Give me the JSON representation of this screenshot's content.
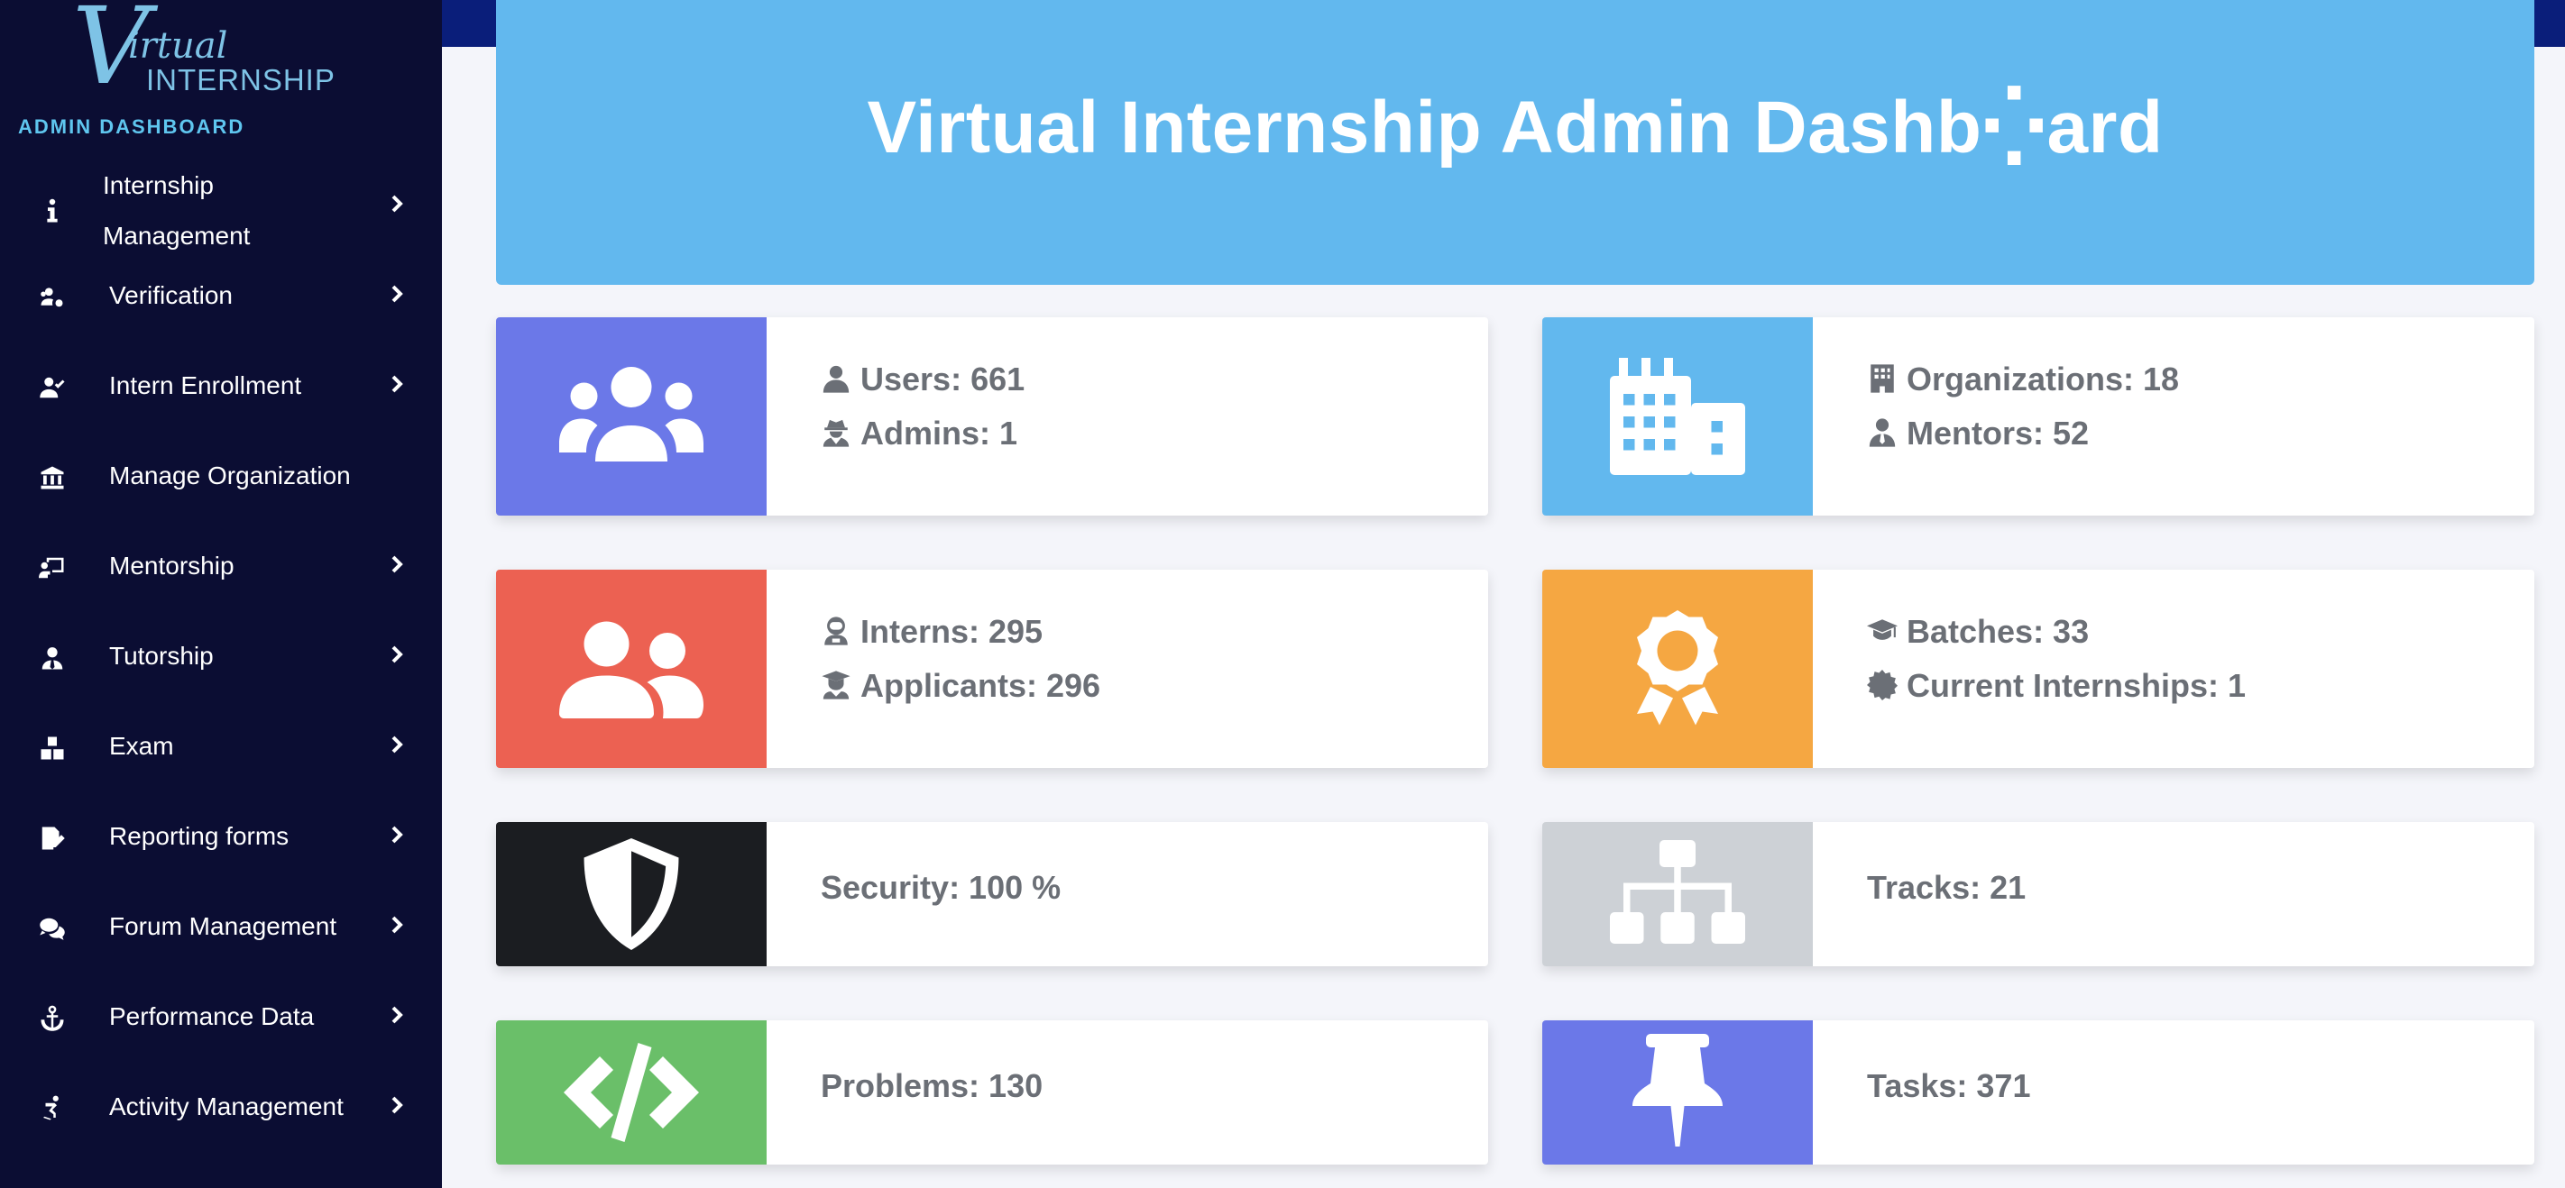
{
  "brand": {
    "logo_v": "V",
    "logo_word1": "irtual",
    "logo_word2": "INTERNSHIP",
    "section_label": "ADMIN DASHBOARD"
  },
  "sidebar": {
    "items": [
      {
        "label": "Internship Management",
        "icon": "info-icon",
        "has_chevron": true
      },
      {
        "label": "Verification",
        "icon": "users-cog-icon",
        "has_chevron": true
      },
      {
        "label": "Intern Enrollment",
        "icon": "user-check-icon",
        "has_chevron": true
      },
      {
        "label": "Manage Organization",
        "icon": "landmark-icon",
        "has_chevron": false
      },
      {
        "label": "Mentorship",
        "icon": "chalkboard-teacher-icon",
        "has_chevron": true
      },
      {
        "label": "Tutorship",
        "icon": "user-tie-icon",
        "has_chevron": true
      },
      {
        "label": "Exam",
        "icon": "cubes-icon",
        "has_chevron": true
      },
      {
        "label": "Reporting forms",
        "icon": "file-signature-icon",
        "has_chevron": true
      },
      {
        "label": "Forum Management",
        "icon": "comments-icon",
        "has_chevron": true
      },
      {
        "label": "Performance Data",
        "icon": "anchor-icon",
        "has_chevron": true
      },
      {
        "label": "Activity Management",
        "icon": "skating-icon",
        "has_chevron": true
      }
    ]
  },
  "header": {
    "title": "Virtual Internship Admin Dashb⁛ard"
  },
  "cards": {
    "users": {
      "color": "#6b78e8",
      "icon": "users-icon",
      "lines": [
        "Users: 661",
        "Admins: 1"
      ],
      "line_icons": [
        "user-icon",
        "user-secret-icon"
      ]
    },
    "orgs": {
      "color": "#62b8ee",
      "icon": "building-icon",
      "lines": [
        "Organizations: 18",
        "Mentors: 52"
      ],
      "line_icons": [
        "building-small-icon",
        "user-tie-small-icon"
      ]
    },
    "interns": {
      "color": "#ec6152",
      "icon": "user-friends-icon",
      "lines": [
        "Interns: 295",
        "Applicants: 296"
      ],
      "line_icons": [
        "user-astronaut-icon",
        "user-graduate-icon"
      ]
    },
    "batches": {
      "color": "#f5a742",
      "icon": "award-icon",
      "lines": [
        "Batches: 33",
        "Current Internships: 1"
      ],
      "line_icons": [
        "graduation-cap-icon",
        "certificate-icon"
      ]
    },
    "security": {
      "color": "#1b1d21",
      "icon": "shield-icon",
      "lines": [
        "Security: 100 %"
      ]
    },
    "tracks": {
      "color": "#cdd1d6",
      "icon": "sitemap-icon",
      "lines": [
        "Tracks: 21"
      ]
    },
    "problems": {
      "color": "#6abf69",
      "icon": "code-icon",
      "lines": [
        "Problems: 130"
      ]
    },
    "tasks": {
      "color": "#6b78e8",
      "icon": "thumbtack-icon",
      "lines": [
        "Tasks: 371"
      ]
    }
  }
}
